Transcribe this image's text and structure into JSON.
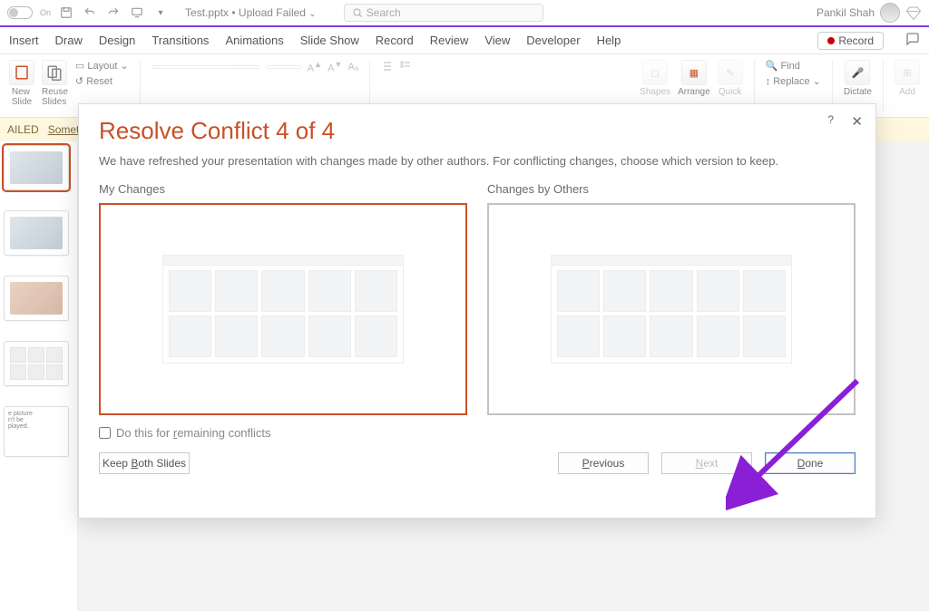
{
  "titlebar": {
    "toggle_label": "On",
    "doc_name": "Test.pptx • Upload Failed",
    "search_placeholder": "Search",
    "user_name": "Pankil Shah"
  },
  "tabs": {
    "items": [
      "Insert",
      "Draw",
      "Design",
      "Transitions",
      "Animations",
      "Slide Show",
      "Record",
      "Review",
      "View",
      "Developer",
      "Help"
    ],
    "record_label": "Record"
  },
  "ribbon": {
    "new_slide": "New\nSlide",
    "reuse": "Reuse\nSlides",
    "layout": "Layout",
    "reset": "Reset",
    "shapes": "Shapes",
    "arrange": "Arrange",
    "quick": "Quick",
    "find": "Find",
    "replace": "Replace",
    "dictate": "Dictate",
    "add": "Add"
  },
  "infobar": {
    "badge": "AILED",
    "link": "Something"
  },
  "thumbs": {
    "note_text": "e picture\nn't be\nplayed."
  },
  "modal": {
    "title": "Resolve Conflict 4 of 4",
    "desc": "We have refreshed your presentation with changes made by other authors. For conflicting changes, choose which version to keep.",
    "left_label": "My Changes",
    "right_label": "Changes by Others",
    "checkbox": "Do this for remaining conflicts",
    "keep_both": "Keep Both Slides",
    "previous": "Previous",
    "next": "Next",
    "done": "Done",
    "current": 4,
    "total": 4
  },
  "colors": {
    "accent": "#c75126",
    "arrow": "#8b1fd6",
    "banner": "#fff6df"
  }
}
